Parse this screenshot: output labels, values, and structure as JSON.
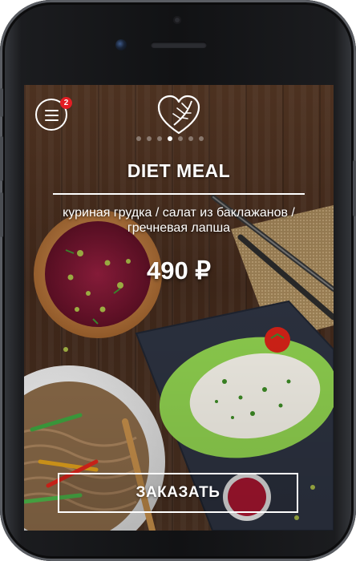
{
  "device": {
    "model": "smartphone"
  },
  "header": {
    "menu_icon": "hamburger-menu-icon",
    "badge_count": "2",
    "logo_icon": "leaf-heart-logo-icon"
  },
  "carousel": {
    "total": 7,
    "active_index": 3
  },
  "meal": {
    "title": "DIET MEAL",
    "description": "куриная грудка / салат из баклажанов / гречневая лапша",
    "price": "490 ₽"
  },
  "actions": {
    "order_label": "ЗАКАЗАТЬ"
  },
  "colors": {
    "accent": "#e31e24",
    "text": "#ffffff"
  }
}
